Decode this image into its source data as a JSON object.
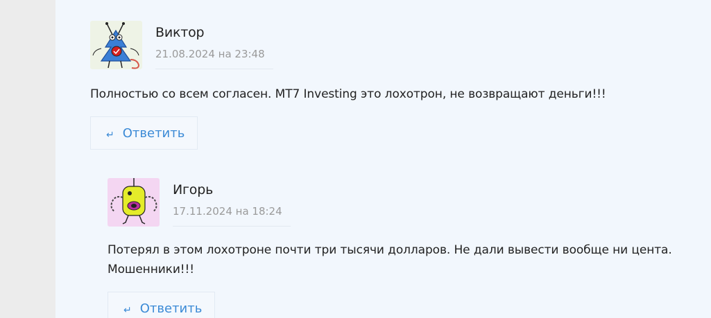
{
  "comments": [
    {
      "author": "Виктор",
      "date": "21.08.2024 на 23:48",
      "text": "Полностью со всем согласен. MT7 Investing это лохотрон, не возвращают деньги!!!",
      "reply_label": "Ответить",
      "avatar_icon": "monster-avatar-blue"
    },
    {
      "author": "Игорь",
      "date": "17.11.2024 на 18:24",
      "text": "Потерял в этом лохотроне почти три тысячи долларов. Не дали вывести вообще ни цента. Мошенники!!!",
      "reply_label": "Ответить",
      "avatar_icon": "monster-avatar-yellow"
    }
  ],
  "icons": {
    "reply": "reply-arrow-icon"
  },
  "colors": {
    "link": "#3b8ad6",
    "page_bg": "#f2f7fd",
    "side_bg": "#ececec"
  }
}
